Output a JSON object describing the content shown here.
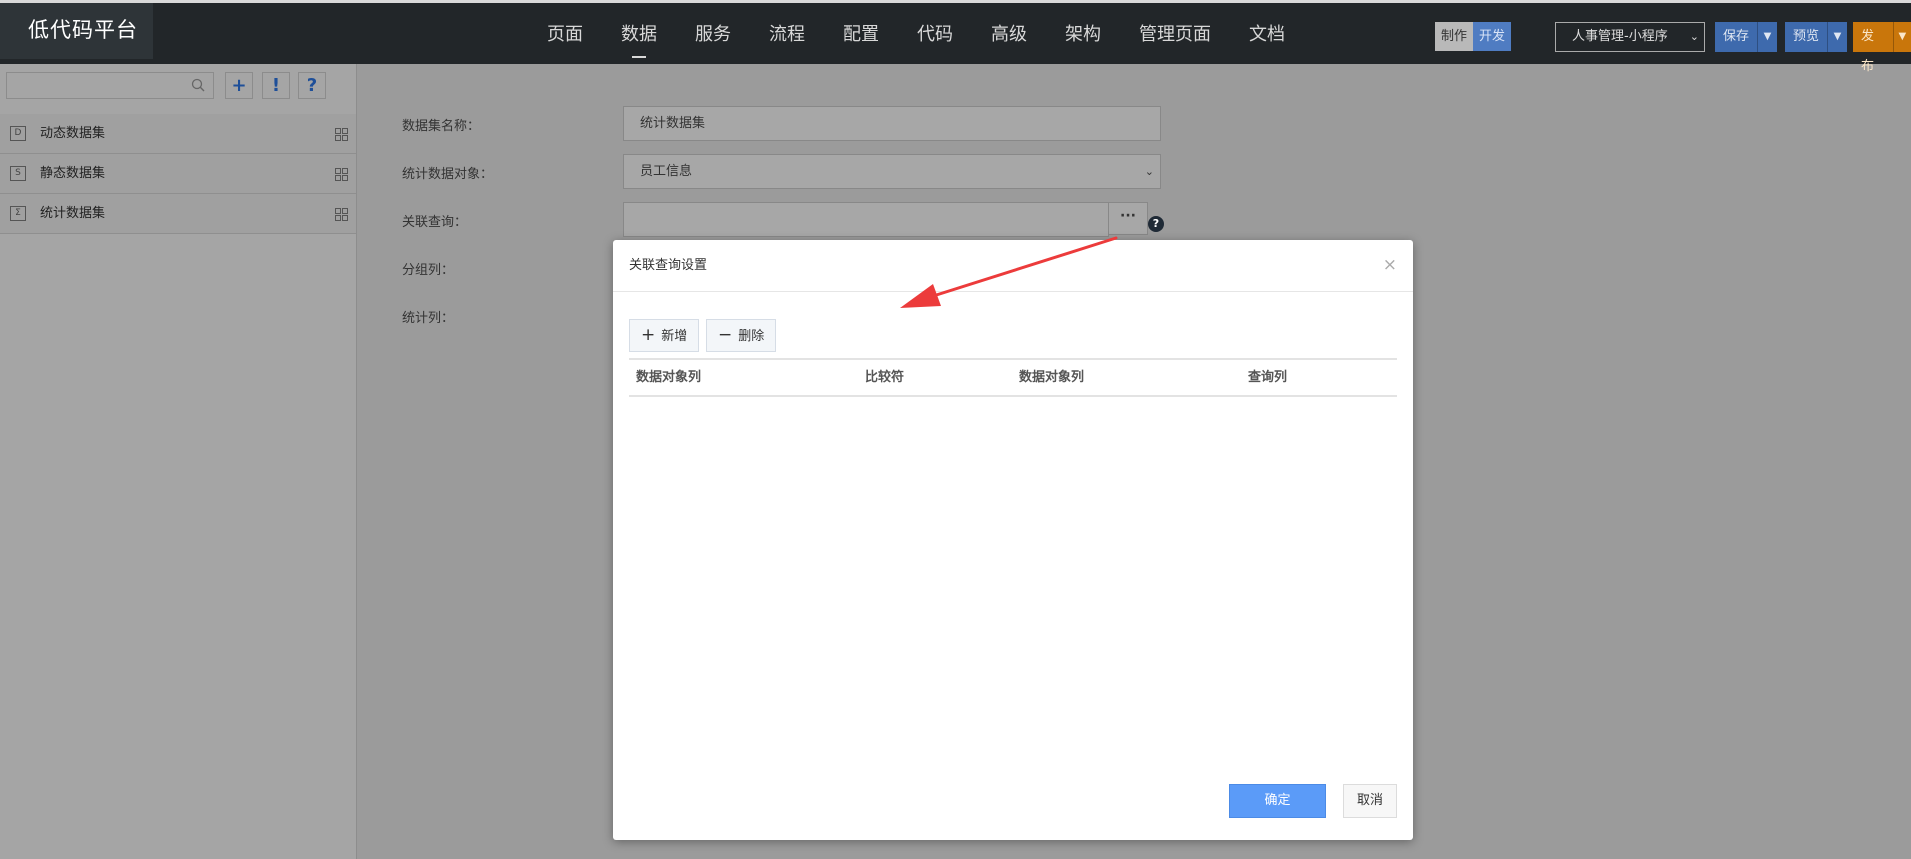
{
  "app": {
    "title": "低代码平台"
  },
  "nav": {
    "items": [
      {
        "label": "页面",
        "active": false
      },
      {
        "label": "数据",
        "active": true
      },
      {
        "label": "服务",
        "active": false
      },
      {
        "label": "流程",
        "active": false
      },
      {
        "label": "配置",
        "active": false
      },
      {
        "label": "代码",
        "active": false
      },
      {
        "label": "高级",
        "active": false
      },
      {
        "label": "架构",
        "active": false
      },
      {
        "label": "管理页面",
        "active": false
      },
      {
        "label": "文档",
        "active": false
      }
    ]
  },
  "toolbar": {
    "mode_make": "制作",
    "mode_dev": "开发",
    "app_select_value": "人事管理-小程序",
    "save_label": "保存",
    "preview_label": "预览",
    "publish_label": "发布"
  },
  "sidebar": {
    "search_placeholder": "",
    "add_symbol": "+",
    "alert_symbol": "!",
    "help_symbol": "?",
    "items": [
      {
        "label": "动态数据集",
        "icon_letter": "D"
      },
      {
        "label": "静态数据集",
        "icon_letter": "S"
      },
      {
        "label": "统计数据集",
        "icon_letter": "Σ"
      }
    ]
  },
  "form": {
    "name_label": "数据集名称：",
    "name_value": "统计数据集",
    "object_label": "统计数据对象：",
    "object_value": "员工信息",
    "relation_label": "关联查询：",
    "relation_value": "",
    "dots": "···",
    "help": "?",
    "group_label": "分组列：",
    "stat_label": "统计列："
  },
  "modal": {
    "title": "关联查询设置",
    "close": "×",
    "add_label": "新增",
    "add_symbol": "+",
    "delete_label": "删除",
    "delete_symbol": "−",
    "columns": [
      "数据对象列",
      "比较符",
      "数据对象列",
      "查询列"
    ],
    "ok_label": "确定",
    "cancel_label": "取消"
  },
  "colors": {
    "accent": "#5b9bf8",
    "annotation_arrow": "#ec3b3b",
    "publish": "#c9760b"
  }
}
